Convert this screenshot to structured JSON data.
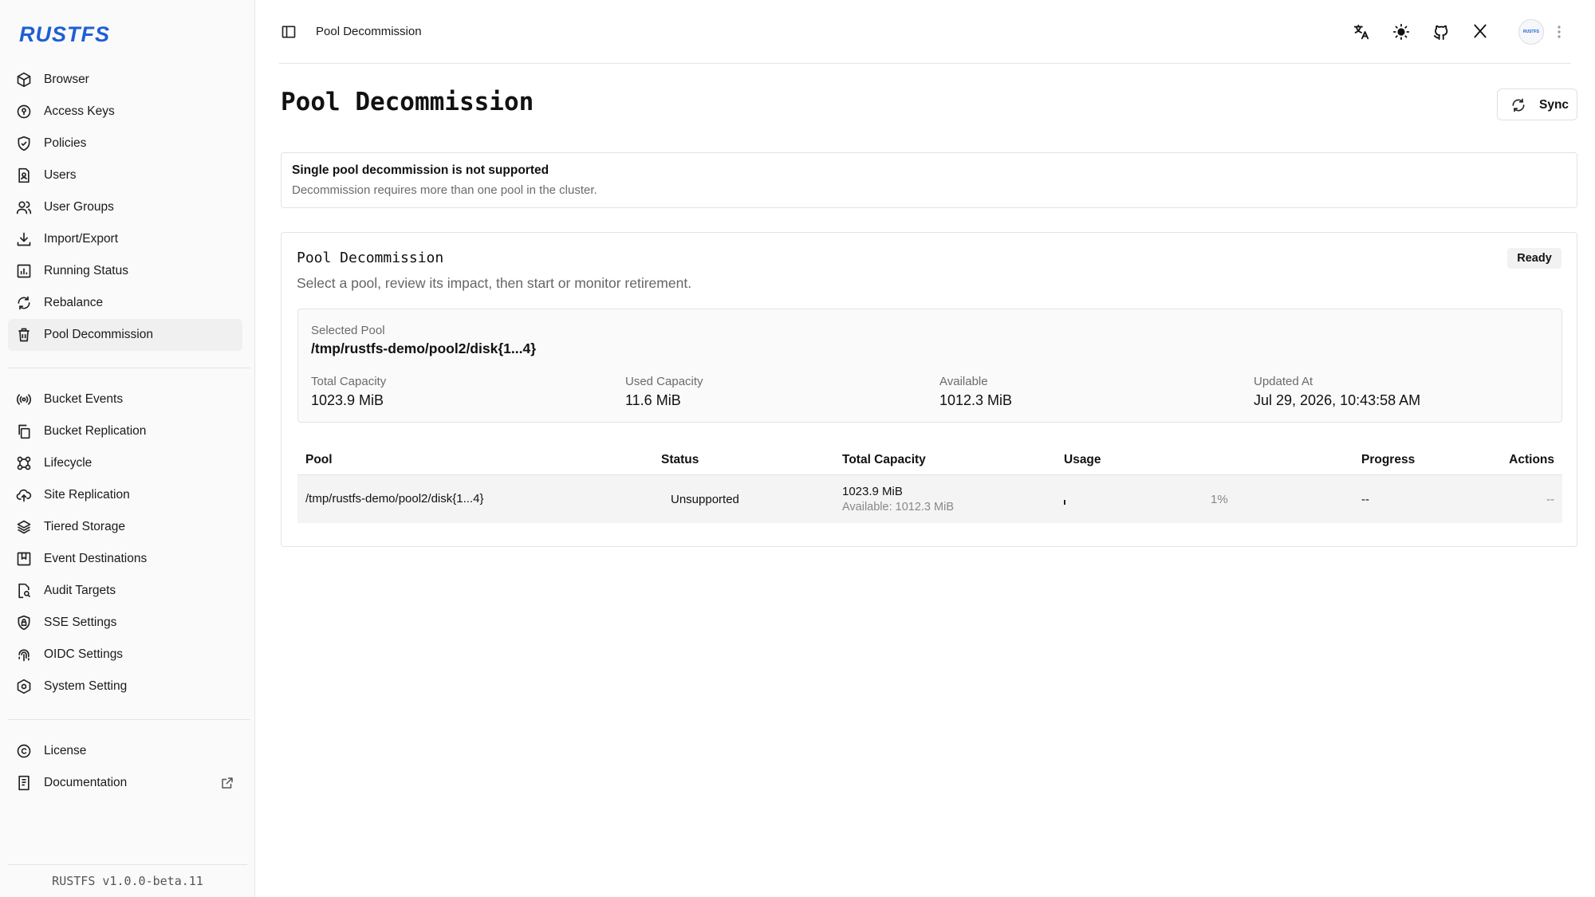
{
  "app": {
    "logo": "RUSTFS",
    "version": "RUSTFS  v1.0.0-beta.11"
  },
  "sidebar": {
    "items": [
      {
        "label": "Browser",
        "icon": "box-icon"
      },
      {
        "label": "Access Keys",
        "icon": "key-circle-icon"
      },
      {
        "label": "Policies",
        "icon": "shield-check-icon"
      },
      {
        "label": "Users",
        "icon": "user-file-icon"
      },
      {
        "label": "User Groups",
        "icon": "users-icon"
      },
      {
        "label": "Import/Export",
        "icon": "download-icon"
      },
      {
        "label": "Running Status",
        "icon": "bar-chart-icon"
      },
      {
        "label": "Rebalance",
        "icon": "refresh-icon"
      },
      {
        "label": "Pool Decommission",
        "icon": "trash-icon",
        "active": true
      }
    ],
    "items2": [
      {
        "label": "Bucket Events",
        "icon": "broadcast-icon"
      },
      {
        "label": "Bucket Replication",
        "icon": "copy-icon"
      },
      {
        "label": "Lifecycle",
        "icon": "lifecycle-icon"
      },
      {
        "label": "Site Replication",
        "icon": "cloud-upload-icon"
      },
      {
        "label": "Tiered Storage",
        "icon": "layers-icon"
      },
      {
        "label": "Event Destinations",
        "icon": "bookmark-icon"
      },
      {
        "label": "Audit Targets",
        "icon": "file-search-icon"
      },
      {
        "label": "SSE Settings",
        "icon": "shield-lock-icon"
      },
      {
        "label": "OIDC Settings",
        "icon": "fingerprint-icon"
      },
      {
        "label": "System Setting",
        "icon": "settings-hex-icon"
      }
    ],
    "items3": [
      {
        "label": "License",
        "icon": "copyright-icon"
      },
      {
        "label": "Documentation",
        "icon": "document-icon"
      }
    ]
  },
  "header": {
    "breadcrumb": "Pool Decommission",
    "avatar_text": "RUSTFS"
  },
  "page": {
    "title": "Pool Decommission",
    "sync_label": "Sync",
    "alert_title": "Single pool decommission is not supported",
    "alert_desc": "Decommission requires more than one pool in the cluster.",
    "card_title": "Pool Decommission",
    "card_subtitle": "Select a pool, review its impact, then start or monitor retirement.",
    "status_badge": "Ready",
    "selected_label": "Selected Pool",
    "selected_value": "/tmp/rustfs-demo/pool2/disk{1...4}",
    "stats": [
      {
        "label": "Total Capacity",
        "value": "1023.9 MiB"
      },
      {
        "label": "Used Capacity",
        "value": "11.6 MiB"
      },
      {
        "label": "Available",
        "value": "1012.3 MiB"
      },
      {
        "label": "Updated At",
        "value": "Jul 29, 2026, 10:43:58 AM"
      }
    ]
  },
  "table": {
    "headers": [
      "Pool",
      "Status",
      "Total Capacity",
      "Usage",
      "Progress",
      "Actions"
    ],
    "rows": [
      {
        "pool": "/tmp/rustfs-demo/pool2/disk{1...4}",
        "status": "Unsupported",
        "total": "1023.9 MiB",
        "available": "Available: 1012.3 MiB",
        "usage_pct_text": "1%",
        "usage_fraction": 0.01,
        "progress": "--",
        "actions": "--"
      }
    ]
  }
}
